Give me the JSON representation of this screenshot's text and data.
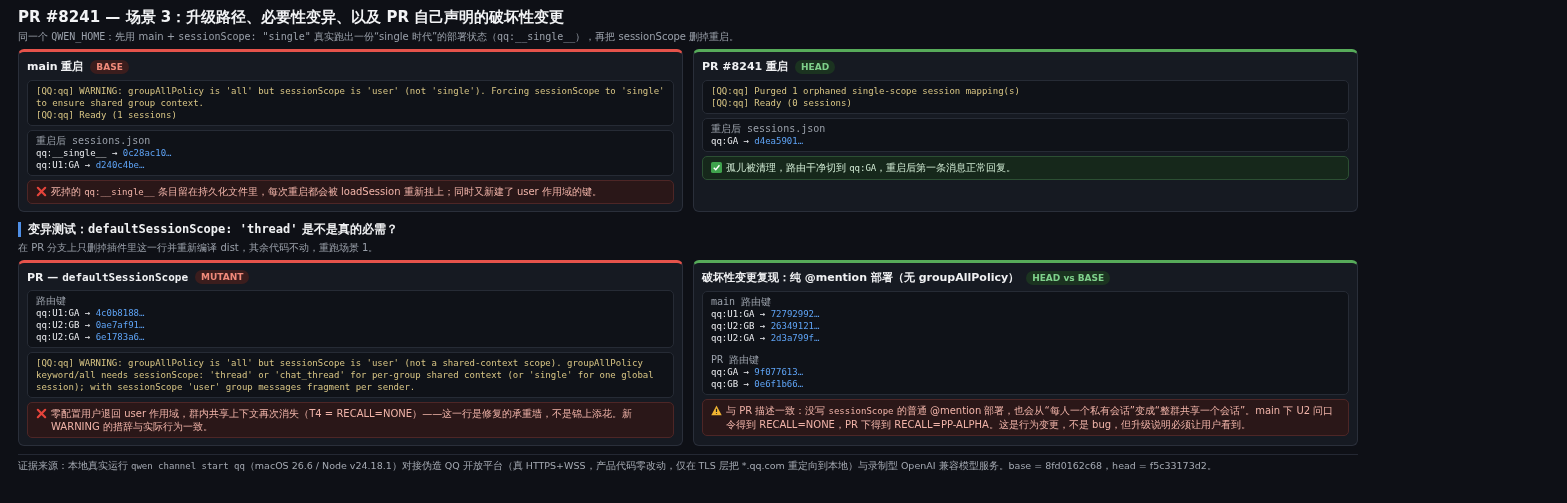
{
  "title": "PR #8241 — 场景 3：升级路径、必要性变异、以及 PR 自己声明的破坏性变更",
  "subtitle": [
    {
      "kind": "text",
      "text": "同一个 "
    },
    {
      "kind": "code",
      "text": "QWEN_HOME"
    },
    {
      "kind": "text",
      "text": "：先用 main + "
    },
    {
      "kind": "code",
      "text": "sessionScope: \"single\""
    },
    {
      "kind": "text",
      "text": " 真实跑出一份“single 时代”的部署状态（"
    },
    {
      "kind": "code",
      "text": "qq:__single__"
    },
    {
      "kind": "text",
      "text": "），再把 sessionScope 删掉重启。"
    }
  ],
  "panels": [
    {
      "passed": false,
      "title": [
        {
          "kind": "text",
          "text": "main 重启"
        }
      ],
      "badge": "BASE",
      "blocks": [
        {
          "kind": "log",
          "lines": [
            "[QQ:qq] WARNING: groupAllPolicy is 'all' but sessionScope is 'user' (not 'single'). Forcing sessionScope to 'single' to ensure shared group context.",
            "[QQ:qq] Ready (1 sessions)"
          ]
        },
        {
          "kind": "map",
          "groups": [
            {
              "label": "重启后 sessions.json",
              "entries": [
                {
                  "key": "qq:__single__",
                  "arrow": "→",
                  "value": "0c28ac10…"
                },
                {
                  "key": "qq:U1:GA",
                  "arrow": "→",
                  "value": "d240c4be…"
                }
              ]
            }
          ]
        },
        {
          "kind": "error",
          "text": [
            {
              "kind": "text",
              "text": "死掉的 "
            },
            {
              "kind": "code",
              "text": "qq:__single__"
            },
            {
              "kind": "text",
              "text": " 条目留在持久化文件里，每次重启都会被 loadSession 重新挂上；同时又新建了 user 作用域的键。"
            }
          ]
        }
      ]
    },
    {
      "passed": true,
      "title": [
        {
          "kind": "text",
          "text": "PR #8241 重启"
        }
      ],
      "badge": "HEAD",
      "blocks": [
        {
          "kind": "log",
          "lines": [
            "[QQ:qq] Purged 1 orphaned single-scope session mapping(s)",
            "[QQ:qq] Ready (0 sessions)"
          ]
        },
        {
          "kind": "map",
          "groups": [
            {
              "label": "重启后 sessions.json",
              "entries": [
                {
                  "key": "qq:GA",
                  "arrow": "→",
                  "value": "d4ea5901…"
                }
              ]
            }
          ]
        },
        {
          "kind": "success",
          "text": [
            {
              "kind": "text",
              "text": "孤儿被清理，路由干净切到 "
            },
            {
              "kind": "code",
              "text": "qq:GA"
            },
            {
              "kind": "text",
              "text": "，重启后第一条消息正常回复。"
            }
          ]
        }
      ]
    }
  ],
  "mutation_section": {
    "heading": [
      {
        "kind": "text",
        "text": "变异测试："
      },
      {
        "kind": "code",
        "text": "defaultSessionScope: 'thread'"
      },
      {
        "kind": "text",
        "text": " 是不是真的必需？"
      }
    ],
    "description": [
      {
        "kind": "text",
        "text": "在 PR 分支上只删掉插件里这一行并重新编译 dist，其余代码不动，重跑场景 1。"
      }
    ],
    "panels": [
      {
        "passed": false,
        "title": [
          {
            "kind": "text",
            "text": "PR — "
          },
          {
            "kind": "code",
            "text": "defaultSessionScope"
          }
        ],
        "badge": "MUTANT",
        "blocks": [
          {
            "kind": "map",
            "groups": [
              {
                "label": "路由键",
                "entries": [
                  {
                    "key": "qq:U1:GA",
                    "arrow": "→",
                    "value": "4c0b8188…"
                  },
                  {
                    "key": "qq:U2:GB",
                    "arrow": "→",
                    "value": "0ae7af91…"
                  },
                  {
                    "key": "qq:U2:GA",
                    "arrow": "→",
                    "value": "6e1783a6…"
                  }
                ]
              }
            ]
          },
          {
            "kind": "log",
            "lines": [
              "[QQ:qq] WARNING: groupAllPolicy is 'all' but sessionScope is 'user' (not a shared-context scope). groupAllPolicy keyword/all needs sessionScope: 'thread' or 'chat_thread' for per-group shared context (or 'single' for one global session); with sessionScope 'user' group messages fragment per sender."
            ]
          },
          {
            "kind": "error",
            "text": [
              {
                "kind": "text",
                "text": "零配置用户退回 user 作用域，群内共享上下文再次消失（T4 = RECALL=NONE）——这一行是修复的承重墙，不是锦上添花。新 WARNING 的措辞与实际行为一致。"
              }
            ]
          }
        ]
      },
      {
        "passed": true,
        "title": [
          {
            "kind": "text",
            "text": "破坏性变更复现：纯 @mention 部署（无 groupAllPolicy）"
          }
        ],
        "badge": "HEAD vs BASE",
        "blocks": [
          {
            "kind": "map",
            "groups": [
              {
                "label": "main 路由键",
                "entries": [
                  {
                    "key": "qq:U1:GA",
                    "arrow": "→",
                    "value": "72792992…"
                  },
                  {
                    "key": "qq:U2:GB",
                    "arrow": "→",
                    "value": "26349121…"
                  },
                  {
                    "key": "qq:U2:GA",
                    "arrow": "→",
                    "value": "2d3a799f…"
                  }
                ]
              },
              {
                "label": "PR 路由键",
                "entries": [
                  {
                    "key": "qq:GA",
                    "arrow": "→",
                    "value": "9f077613…"
                  },
                  {
                    "key": "qq:GB",
                    "arrow": "→",
                    "value": "0e6f1b66…"
                  }
                ]
              }
            ]
          },
          {
            "kind": "warning",
            "text": [
              {
                "kind": "text",
                "text": "与 PR 描述一致：没写 "
              },
              {
                "kind": "code",
                "text": "sessionScope"
              },
              {
                "kind": "text",
                "text": " 的普通 @mention 部署，也会从“每人一个私有会话”变成“整群共享一个会话”。main 下 U2 问口令得到 RECALL=NONE，PR 下得到 RECALL=PP-ALPHA。这是行为变更，不是 bug，但升级说明必须让用户看到。"
              }
            ]
          }
        ]
      }
    ]
  },
  "footer": [
    {
      "kind": "text",
      "text": "证据来源：本地真实运行 "
    },
    {
      "kind": "code",
      "text": "qwen channel start qq"
    },
    {
      "kind": "text",
      "text": "（macOS 26.6 / Node v24.18.1）对接伪造 QQ 开放平台（真 HTTPS+WSS，产品代码零改动，仅在 TLS 层把 *.qq.com 重定向到本地）与录制型 OpenAI 兼容模型服务。base = 8fd0162c68，head = f5c33173d2。"
    }
  ]
}
